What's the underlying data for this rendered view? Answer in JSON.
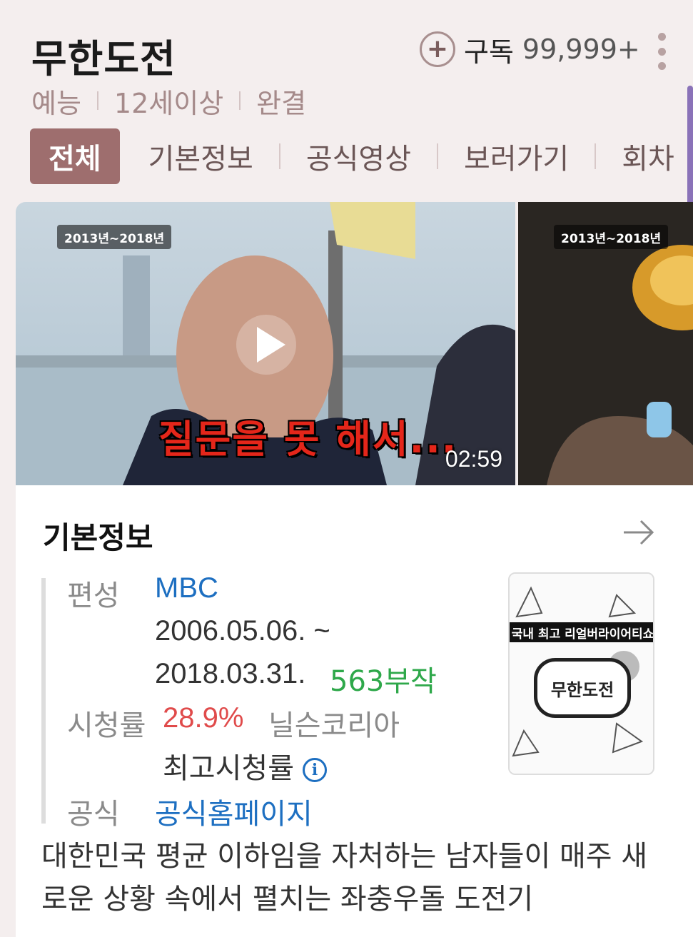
{
  "header": {
    "title": "무한도전",
    "subscribe_label": "구독",
    "subscribe_count": "99,999+",
    "meta": [
      "예능",
      "12세이상",
      "완결"
    ]
  },
  "tabs": [
    "전체",
    "기본정보",
    "공식영상",
    "보러가기",
    "회차"
  ],
  "media": {
    "badge": "2013년~2018년",
    "caption": "질문을 못 해서...",
    "duration": "02:59"
  },
  "info": {
    "title": "기본정보",
    "broadcast_label": "편성",
    "broadcaster": "MBC",
    "date_start": "2006.05.06. ~",
    "date_end": "2018.03.31.",
    "episodes": "563부작",
    "rating_label": "시청률",
    "rating_value": "28.9%",
    "rating_source": "닐슨코리아",
    "rating_note": "최고시청률",
    "official_label": "공식",
    "official_link": "공식홈페이지",
    "poster_banner": "국내 최고 리얼버라이어티쇼",
    "poster_logo": "무한도전",
    "description": "대한민국 평균 이하임을 자처하는 남자들이 매주 새로운 상황 속에서 펼치는 좌충우돌 도전기"
  },
  "colors": {
    "accent": "#9e6e6e",
    "background": "#f4eeee",
    "link": "#1d6fc1",
    "episodes": "#2ea84a",
    "rating": "#e04b4b"
  }
}
